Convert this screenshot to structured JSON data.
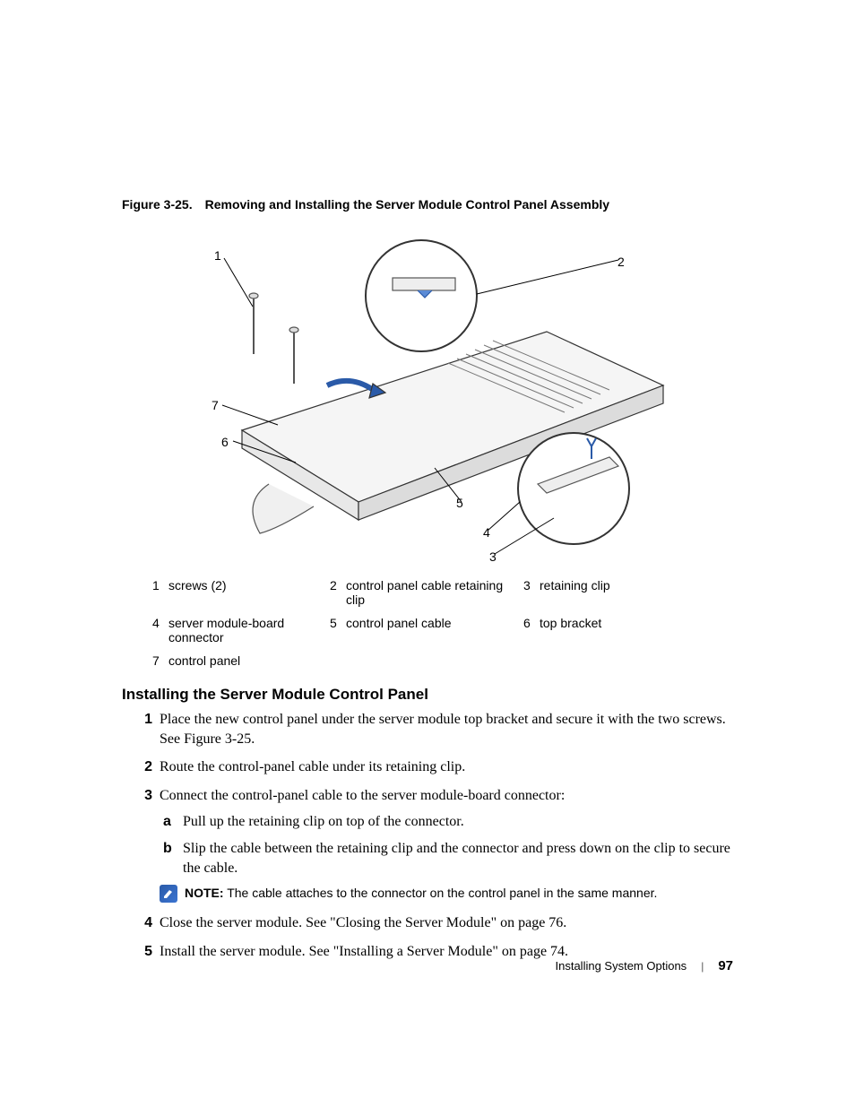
{
  "figure": {
    "label": "Figure 3-25.",
    "title": "Removing and Installing the Server Module Control Panel Assembly",
    "callouts": {
      "c1": "1",
      "c2": "2",
      "c3": "3",
      "c4": "4",
      "c5": "5",
      "c6": "6",
      "c7": "7"
    }
  },
  "legend": {
    "r1": {
      "n1": "1",
      "t1": "screws (2)",
      "n2": "2",
      "t2": "control panel cable retaining clip",
      "n3": "3",
      "t3": "retaining clip"
    },
    "r2": {
      "n1": "4",
      "t1": "server module-board connector",
      "n2": "5",
      "t2": "control panel cable",
      "n3": "6",
      "t3": "top bracket"
    },
    "r3": {
      "n1": "7",
      "t1": "control panel"
    }
  },
  "heading": "Installing the Server Module Control Panel",
  "steps": {
    "s1": {
      "n": "1",
      "t": "Place the new control panel under the server module top bracket and secure it with the two screws. See Figure 3-25."
    },
    "s2": {
      "n": "2",
      "t": "Route the control-panel cable under its retaining clip."
    },
    "s3": {
      "n": "3",
      "t": "Connect the control-panel cable to the server module-board connector:"
    },
    "s3a": {
      "n": "a",
      "t": "Pull up the retaining clip on top of the connector."
    },
    "s3b": {
      "n": "b",
      "t": "Slip the cable between the retaining clip and the connector and press down on the clip to secure the cable."
    },
    "note": {
      "label": "NOTE:",
      "t": " The cable attaches to the connector on the control panel in the same manner."
    },
    "s4": {
      "n": "4",
      "t": "Close the server module. See \"Closing the Server Module\" on page 76."
    },
    "s5": {
      "n": "5",
      "t": "Install the server module. See \"Installing a Server Module\" on page 74."
    }
  },
  "footer": {
    "section": "Installing System Options",
    "page": "97"
  }
}
